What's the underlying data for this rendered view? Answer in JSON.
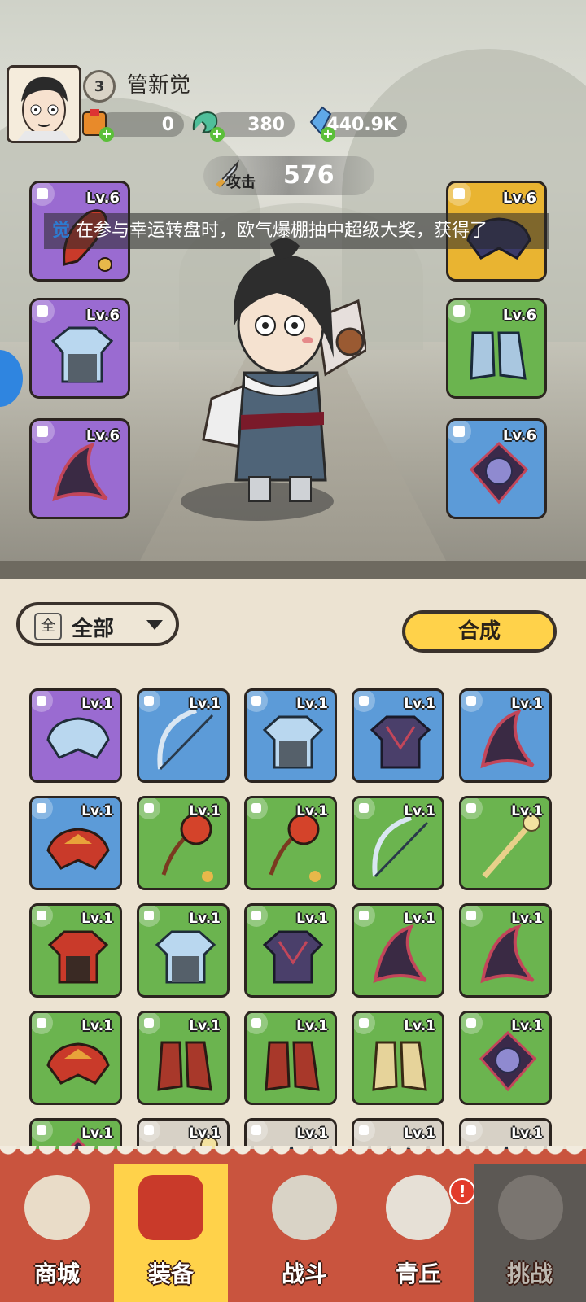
{
  "player": {
    "level": "3",
    "name": "管新觉",
    "resources": [
      {
        "icon": "gift-bag-icon",
        "value": "0"
      },
      {
        "icon": "jade-dragon-icon",
        "value": "380"
      },
      {
        "icon": "crystal-icon",
        "value": "440.9K"
      }
    ]
  },
  "power": {
    "label": "攻击",
    "value": "576"
  },
  "ticker": {
    "prefix": "觉",
    "text": "在参与幸运转盘时，欧气爆棚抽中超级大奖，获得了"
  },
  "equipped": [
    {
      "slot": "weapon",
      "level": "Lv.6",
      "rarity": "purple"
    },
    {
      "slot": "helmet",
      "level": "Lv.6",
      "rarity": "gold"
    },
    {
      "slot": "armor",
      "level": "Lv.6",
      "rarity": "purple"
    },
    {
      "slot": "boots",
      "level": "Lv.6",
      "rarity": "green"
    },
    {
      "slot": "ring",
      "level": "Lv.6",
      "rarity": "purple"
    },
    {
      "slot": "amulet",
      "level": "Lv.6",
      "rarity": "blue"
    }
  ],
  "filter": {
    "icon_text": "全",
    "label": "全部"
  },
  "combine_button": "合成",
  "inventory": [
    {
      "level": "Lv.1",
      "rarity": "purple",
      "item": "helmet"
    },
    {
      "level": "Lv.1",
      "rarity": "blue",
      "item": "bow"
    },
    {
      "level": "Lv.1",
      "rarity": "blue",
      "item": "armor"
    },
    {
      "level": "Lv.1",
      "rarity": "blue",
      "item": "armor-dark"
    },
    {
      "level": "Lv.1",
      "rarity": "blue",
      "item": "ring"
    },
    {
      "level": "Lv.1",
      "rarity": "blue",
      "item": "helmet-red"
    },
    {
      "level": "Lv.1",
      "rarity": "green",
      "item": "mace"
    },
    {
      "level": "Lv.1",
      "rarity": "green",
      "item": "mace"
    },
    {
      "level": "Lv.1",
      "rarity": "green",
      "item": "bow"
    },
    {
      "level": "Lv.1",
      "rarity": "green",
      "item": "staff"
    },
    {
      "level": "Lv.1",
      "rarity": "green",
      "item": "armor-red"
    },
    {
      "level": "Lv.1",
      "rarity": "green",
      "item": "armor"
    },
    {
      "level": "Lv.1",
      "rarity": "green",
      "item": "armor-dark"
    },
    {
      "level": "Lv.1",
      "rarity": "green",
      "item": "ring"
    },
    {
      "level": "Lv.1",
      "rarity": "green",
      "item": "ring"
    },
    {
      "level": "Lv.1",
      "rarity": "green",
      "item": "helmet-red"
    },
    {
      "level": "Lv.1",
      "rarity": "green",
      "item": "boots-red"
    },
    {
      "level": "Lv.1",
      "rarity": "green",
      "item": "boots-red"
    },
    {
      "level": "Lv.1",
      "rarity": "green",
      "item": "boots-gold"
    },
    {
      "level": "Lv.1",
      "rarity": "green",
      "item": "amulet"
    },
    {
      "level": "Lv.1",
      "rarity": "green",
      "item": "amulet"
    },
    {
      "level": "Lv.1",
      "rarity": "grey",
      "item": "staff"
    },
    {
      "level": "Lv.1",
      "rarity": "grey",
      "item": "helmet"
    },
    {
      "level": "Lv.1",
      "rarity": "grey",
      "item": "helmet"
    },
    {
      "level": "Lv.1",
      "rarity": "grey",
      "item": "helmet"
    }
  ],
  "nav": [
    {
      "label": "商城",
      "icon": "shop-icon",
      "state": "normal"
    },
    {
      "label": "装备",
      "icon": "equipment-icon",
      "state": "active"
    },
    {
      "label": "战斗",
      "icon": "crossed-swords-icon",
      "state": "normal"
    },
    {
      "label": "青丘",
      "icon": "mountain-icon",
      "state": "alert"
    },
    {
      "label": "挑战",
      "icon": "challenge-icon",
      "state": "locked"
    }
  ],
  "alert_badge": "!",
  "colors": {
    "purple": "#9a6bd1",
    "blue": "#5c9bd8",
    "green": "#6bb44f",
    "gold": "#e9b431",
    "grey": "#d7d1c6",
    "nav_bg": "#c9543e",
    "active_tab": "#ffd24a"
  }
}
